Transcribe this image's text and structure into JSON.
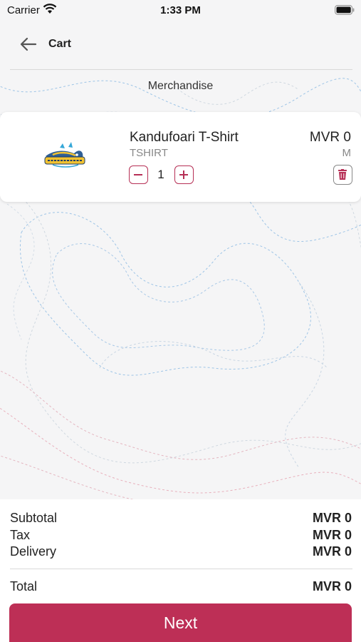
{
  "status_bar": {
    "carrier": "Carrier",
    "time": "1:33 PM"
  },
  "header": {
    "title": "Cart",
    "back_icon": "arrow-left-icon"
  },
  "category": "Merchandise",
  "cart_items": [
    {
      "name": "Kandufoari T-Shirt",
      "sku": "TSHIRT",
      "price": "MVR 0",
      "size": "M",
      "quantity": "1"
    }
  ],
  "summary": {
    "subtotal_label": "Subtotal",
    "subtotal_value": "MVR 0",
    "tax_label": "Tax",
    "tax_value": "MVR 0",
    "delivery_label": "Delivery",
    "delivery_value": "MVR 0",
    "total_label": "Total",
    "total_value": "MVR 0"
  },
  "next_button": "Next",
  "colors": {
    "accent": "#bd2f56",
    "background": "#f5f5f6",
    "card": "#ffffff"
  }
}
